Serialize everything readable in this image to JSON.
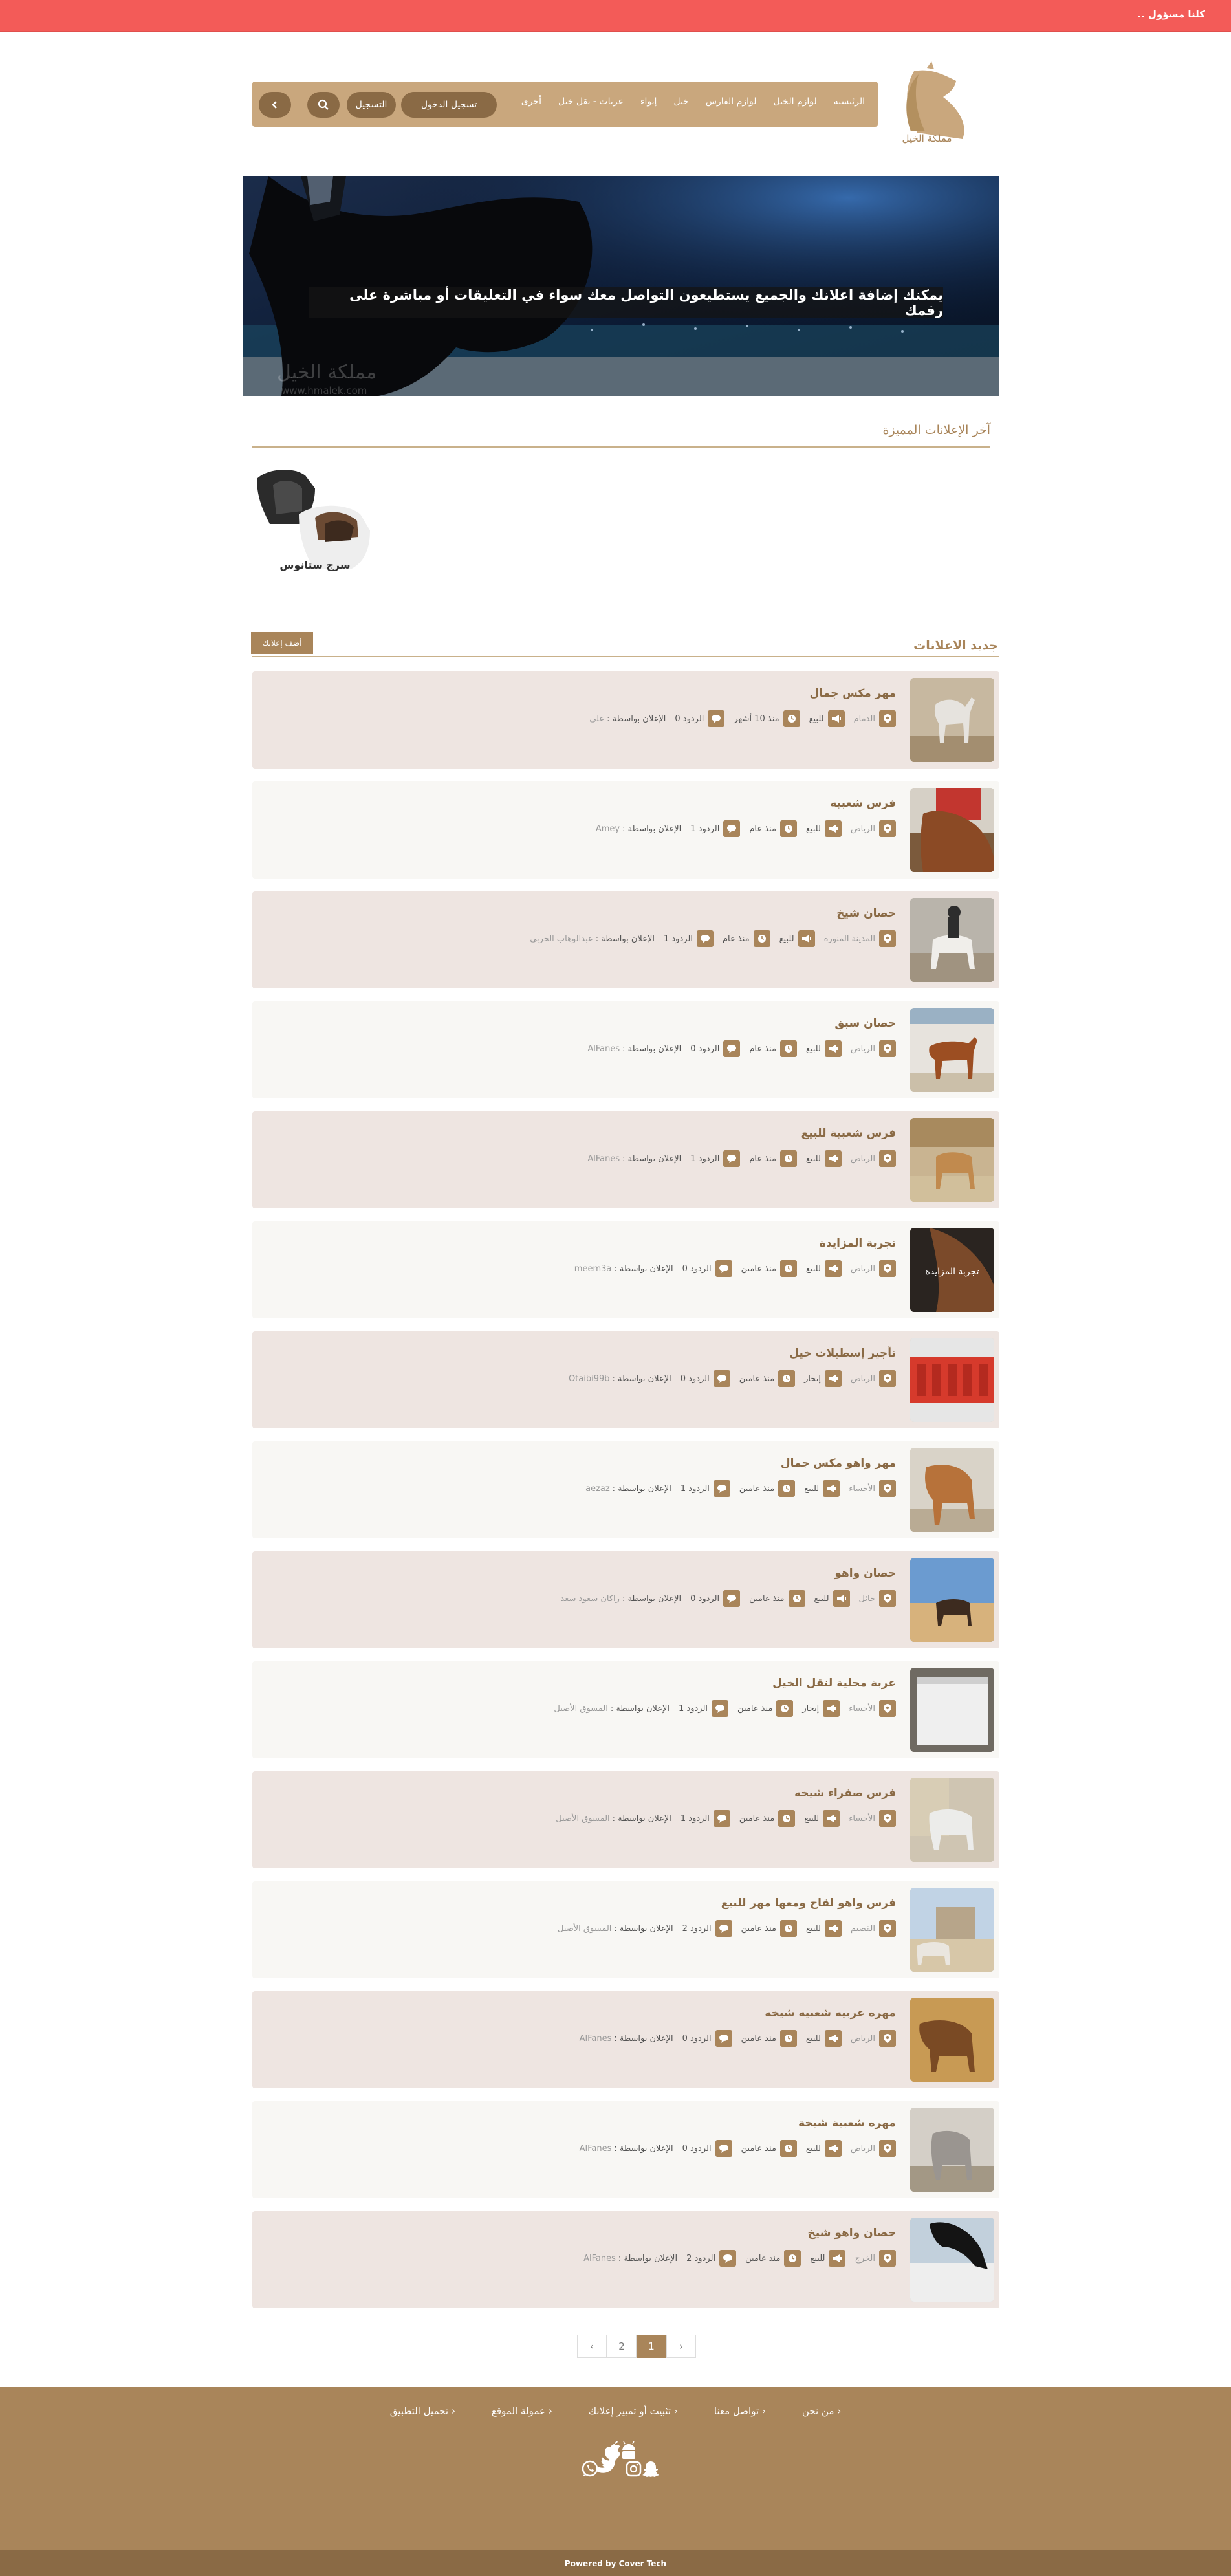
{
  "topbar": {
    "text": "كلنا مسؤول .."
  },
  "logo": {
    "name": "مملكة الخيل"
  },
  "nav": {
    "links": [
      "الرئيسية",
      "لوازم الخيل",
      "لوازم الفارس",
      "خيل",
      "إيواء",
      "عربات - نقل خيل",
      "أخرى"
    ],
    "login": "تسجيل الدخول",
    "register": "التسجيل"
  },
  "hero": {
    "caption": "يمكنك إضافة اعلانك والجميع يستطيعون التواصل معك سواء في التعليقات أو مباشرة على رقمك",
    "watermark": "مملكة الخيل",
    "watermark_url": "www.hmalek.com"
  },
  "featured": {
    "title": "آخر الإعلانات المميزة",
    "items": [
      {
        "title": "سرج ستانوس"
      }
    ]
  },
  "ads_section": {
    "title": "جديد الاعلانات",
    "add_button": "أضف إعلانك"
  },
  "ads": [
    {
      "title": "مهر مكس جمال",
      "city": "الدمام",
      "type": "للبيع",
      "time": "منذ 10 أشهر",
      "replies": "الردود 0",
      "author_label": "الإعلان بواسطة :",
      "author": "علي"
    },
    {
      "title": "فرس شعبيه",
      "city": "الرياض",
      "type": "للبيع",
      "time": "منذ عام",
      "replies": "الردود 1",
      "author_label": "الإعلان بواسطة :",
      "author": "Amey"
    },
    {
      "title": "حصان شيخ",
      "city": "المدينة المنورة",
      "type": "للبيع",
      "time": "منذ عام",
      "replies": "الردود 1",
      "author_label": "الإعلان بواسطة :",
      "author": "عبدالوهاب الحربي"
    },
    {
      "title": "حصان سبق",
      "city": "الرياض",
      "type": "للبيع",
      "time": "منذ عام",
      "replies": "الردود 0",
      "author_label": "الإعلان بواسطة :",
      "author": "AlFanes"
    },
    {
      "title": "فرس شعبية للبيع",
      "city": "الرياض",
      "type": "للبيع",
      "time": "منذ عام",
      "replies": "الردود 1",
      "author_label": "الإعلان بواسطة :",
      "author": "AlFanes"
    },
    {
      "title": "تجربة المزايدة",
      "city": "الرياض",
      "type": "للبيع",
      "time": "منذ عامين",
      "replies": "الردود 0",
      "author_label": "الإعلان بواسطة :",
      "author": "meem3a"
    },
    {
      "title": "تأجير إسطبلات خيل",
      "city": "الرياض",
      "type": "إيجار",
      "time": "منذ عامين",
      "replies": "الردود 0",
      "author_label": "الإعلان بواسطة :",
      "author": "Otaibi99b"
    },
    {
      "title": "مهر واهو مكس جمال",
      "city": "الأحساء",
      "type": "للبيع",
      "time": "منذ عامين",
      "replies": "الردود 1",
      "author_label": "الإعلان بواسطة :",
      "author": "aezaz"
    },
    {
      "title": "حصان واهو",
      "city": "حائل",
      "type": "للبيع",
      "time": "منذ عامين",
      "replies": "الردود 0",
      "author_label": "الإعلان بواسطة :",
      "author": "راكان سعود سعد"
    },
    {
      "title": "عربة محلية لنقل الخيل",
      "city": "الأحساء",
      "type": "إيجار",
      "time": "منذ عامين",
      "replies": "الردود 1",
      "author_label": "الإعلان بواسطة :",
      "author": "المسوق الأصيل"
    },
    {
      "title": "فرس صفراء شيخه",
      "city": "الأحساء",
      "type": "للبيع",
      "time": "منذ عامين",
      "replies": "الردود 1",
      "author_label": "الإعلان بواسطة :",
      "author": "المسوق الأصيل"
    },
    {
      "title": "فرس واهو لقاح ومعها مهر للبيع",
      "city": "القصيم",
      "type": "للبيع",
      "time": "منذ عامين",
      "replies": "الردود 2",
      "author_label": "الإعلان بواسطة :",
      "author": "المسوق الأصيل"
    },
    {
      "title": "مهره عربيه شعبيه شيخه",
      "city": "الرياض",
      "type": "للبيع",
      "time": "منذ عامين",
      "replies": "الردود 0",
      "author_label": "الإعلان بواسطة :",
      "author": "AlFanes"
    },
    {
      "title": "مهره شعبية شيخة",
      "city": "الرياض",
      "type": "للبيع",
      "time": "منذ عامين",
      "replies": "الردود 0",
      "author_label": "الإعلان بواسطة :",
      "author": "AlFanes"
    },
    {
      "title": "حصان واهو شيخ",
      "city": "الخرج",
      "type": "للبيع",
      "time": "منذ عامين",
      "replies": "الردود 2",
      "author_label": "الإعلان بواسطة :",
      "author": "AlFanes"
    }
  ],
  "ad_thumb_text": "تجربة المزايدة",
  "pagination": {
    "prev": "‹",
    "pages": [
      "1",
      "2"
    ],
    "next": "›",
    "active": "1"
  },
  "footer": {
    "links": [
      "من نحن",
      "تواصل معنا",
      "تثبيت أو تمييز إعلانك",
      "عمولة الموقع",
      "تحميل التطبيق"
    ],
    "powered": "Powered by Cover Tech"
  },
  "colors": {
    "brand": "#a9855a",
    "topbar": "#f35b58",
    "nav": "#c9a77d",
    "card_odd": "#eee5e1",
    "card_even": "#f8f7f4"
  }
}
